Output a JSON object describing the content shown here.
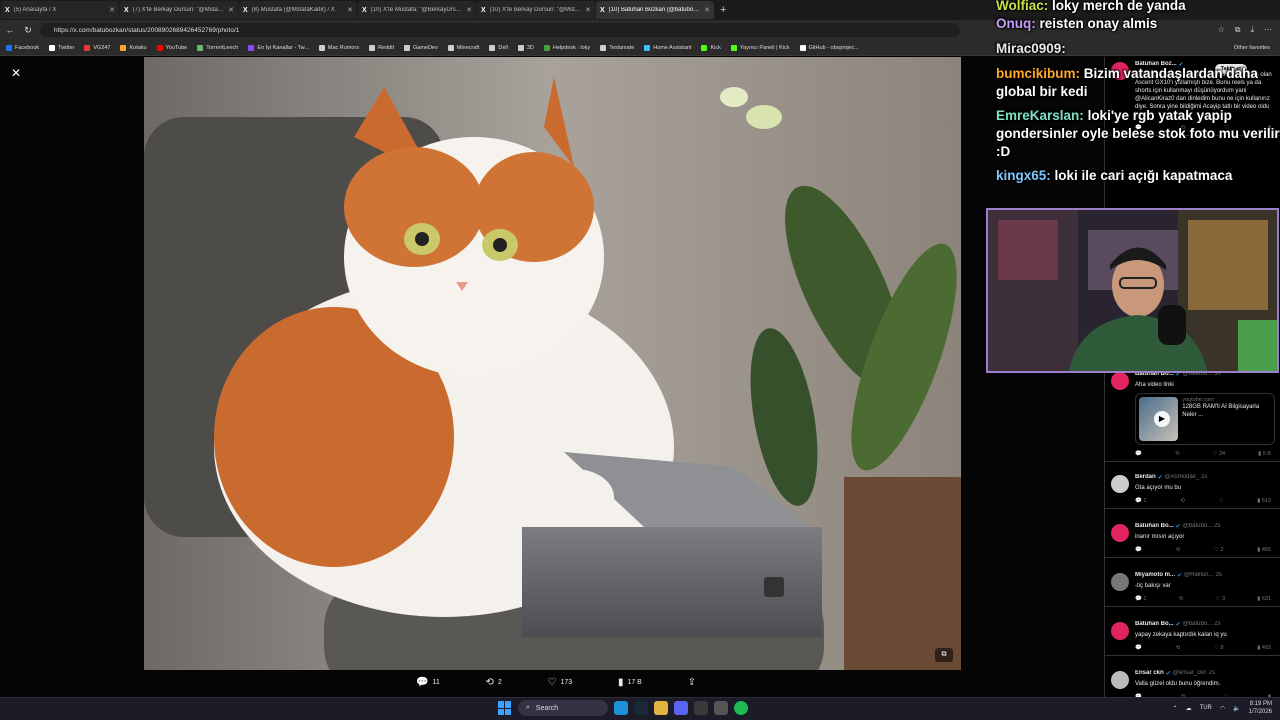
{
  "tabs": [
    {
      "title": "(5) Anasayfa / X",
      "active": false
    },
    {
      "title": "(7) X'te Berkay Dursun: \"@Mstafa...",
      "active": false
    },
    {
      "title": "(8) Mustafa (@MstafaKadir) / X",
      "active": false
    },
    {
      "title": "(10) X'te Mustafa: \"@BerkayDrsn...",
      "active": false
    },
    {
      "title": "(10) X'te Berkay Dursun: \"@Mstafa...",
      "active": false
    },
    {
      "title": "(10) Batuhan Bozkan (@batubozk...",
      "active": true
    }
  ],
  "address": {
    "url": "https://x.com/batubozkan/status/2008902689426452769/photo/1"
  },
  "bookmarks": [
    {
      "label": "Facebook",
      "color": "#1877f2"
    },
    {
      "label": "Twitter",
      "color": "#ffffff"
    },
    {
      "label": "VG247",
      "color": "#e53935"
    },
    {
      "label": "Kotaku",
      "color": "#f9a825"
    },
    {
      "label": "YouTube",
      "color": "#ff0000"
    },
    {
      "label": "TorrentLeech",
      "color": "#66bb6a"
    },
    {
      "label": "En İyi Kanallar - Tw...",
      "color": "#9146ff"
    },
    {
      "label": "Mac Rumors",
      "color": "#cccccc"
    },
    {
      "label": "Reddit",
      "color": "#cccccc"
    },
    {
      "label": "GameDev",
      "color": "#cccccc"
    },
    {
      "label": "Minecraft",
      "color": "#cccccc"
    },
    {
      "label": "Dell",
      "color": "#cccccc"
    },
    {
      "label": "3D",
      "color": "#cccccc"
    },
    {
      "label": "Helpdesk : loky",
      "color": "#43a047"
    },
    {
      "label": "Teslamate",
      "color": "#cccccc"
    },
    {
      "label": "Home Assistant",
      "color": "#41bdf5"
    },
    {
      "label": "Kick",
      "color": "#53fc18"
    },
    {
      "label": "Yayıncı Paneli | Kick",
      "color": "#53fc18"
    },
    {
      "label": "GitHub - obsprojec...",
      "color": "#ffffff"
    }
  ],
  "bookmarks_other": "Other favorites",
  "photo_actions": {
    "replies": "11",
    "reposts": "2",
    "likes": "173",
    "views": "17 B"
  },
  "chat": [
    {
      "user": "Wolfiac:",
      "color": "#c7e04a",
      "msg": "loky merch de yanda"
    },
    {
      "user": "Onuq:",
      "color": "#c9a0ff",
      "msg": "reisten onay almis"
    },
    {
      "user": "Mirac0909:",
      "color": "#e9e9e9",
      "msg": ""
    },
    {
      "user": "bumcikibum:",
      "color": "#ffa726",
      "msg": "Bizim vatandaşlardan daha global bir kedi"
    },
    {
      "user": "EmreKarslan:",
      "color": "#7ee0c4",
      "msg": "loki'ye rgb yatak yapip gondersinler oyle belese stok foto mu verilir :D"
    },
    {
      "user": "kingx65:",
      "color": "#7ec8ff",
      "msg": "loki ile cari açığı kapatmaca"
    }
  ],
  "replies": [
    {
      "name": "Batuhan Boz...",
      "handle": "",
      "time": "",
      "text": "ASUS geçenlerde içinde 128GB birleşik hafıza olan Ascent GX10'ı yollamıştı bize. Bunu reels ya da shorts için kullanmayı düşünüyordum yani @AlicanKiraz0 dan dinledim bunu ne için kullanırız diye. Sonra yine bildiğimi Acayip tatlı bir video oldu bence",
      "avatar": "#e0245e",
      "follow": "Takip et",
      "stats": [
        "",
        "",
        "",
        ""
      ]
    },
    {
      "name": "Batuhan Bo...",
      "handle": "@batubo...",
      "time": "3s",
      "text": "Aha video linki",
      "avatar": "#e0245e",
      "card": {
        "domain": "youtube.com",
        "title": "128GB RAM'li AI Bilgisayarla Neler ..."
      },
      "stats": [
        "",
        "",
        "24",
        "5 B"
      ]
    },
    {
      "name": "Berdan",
      "handle": "@Asmodax_",
      "time": "2s",
      "text": "Gta açıyor mu bu",
      "avatar": "#cccccc",
      "stats": [
        "1",
        "",
        "",
        "513"
      ]
    },
    {
      "name": "Batuhan Bo...",
      "handle": "@batubo...",
      "time": "2s",
      "text": "inanır mısın açıyor",
      "avatar": "#e0245e",
      "stats": [
        "",
        "",
        "2",
        "455"
      ]
    },
    {
      "name": "Miyamoto m...",
      "handle": "@Halilun...",
      "time": "3s",
      "text": "-tiç bakışı var",
      "avatar": "#777777",
      "stats": [
        "1",
        "",
        "3",
        "631"
      ]
    },
    {
      "name": "Batuhan Bo...",
      "handle": "@batubo...",
      "time": "2s",
      "text": "yapay zekaya kaptırdık kalan iq yu",
      "avatar": "#e0245e",
      "stats": [
        "",
        "",
        "8",
        "493"
      ]
    },
    {
      "name": "Ensar ckn",
      "handle": "@ensar_ckn",
      "time": "2s",
      "text": "Valla güzel oldu bunu öğrendim.",
      "avatar": "#bbbbbb",
      "stats": [
        "",
        "",
        "",
        ""
      ]
    }
  ],
  "taskbar": {
    "search": "Search",
    "lang": "TUR",
    "time": "8:19 PM",
    "date": "1/7/2026"
  }
}
